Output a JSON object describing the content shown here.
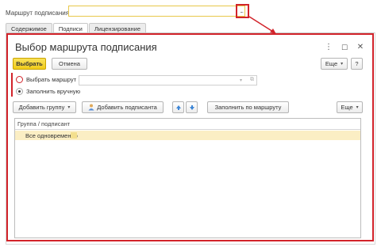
{
  "form": {
    "route_label": "Маршрут подписания:",
    "route_value": "",
    "route_dots": "..."
  },
  "tabs": [
    {
      "label": "Содержимое"
    },
    {
      "label": "Подписи"
    },
    {
      "label": "Лицензирование"
    }
  ],
  "dialog": {
    "title": "Выбор маршрута подписания",
    "controls": {
      "menu": "⋮",
      "maximize": "☐",
      "close": "✕"
    },
    "toolbar": {
      "select_label": "Выбрать",
      "cancel_label": "Отмена",
      "more_label": "Еще",
      "help_label": "?"
    },
    "mode": {
      "route_option_label": "Выбрать маршрут",
      "manual_option_label": "Заполнить вручную",
      "selected": "manual"
    },
    "route_select": {
      "value": "",
      "caret": "▾",
      "open_icon": "⧉"
    },
    "actions": {
      "add_group_label": "Добавить группу",
      "add_signer_label": "Добавить подписанта",
      "fill_by_route_label": "Заполнить по маршруту",
      "more_label": "Еще"
    },
    "grid": {
      "column_header": "Группа / подписант",
      "rows": [
        {
          "label": "Все одновременно"
        }
      ]
    }
  },
  "colors": {
    "accent_red": "#d2232a",
    "primary_button": "#f1cc1a",
    "row_highlight": "#fbeec4"
  }
}
